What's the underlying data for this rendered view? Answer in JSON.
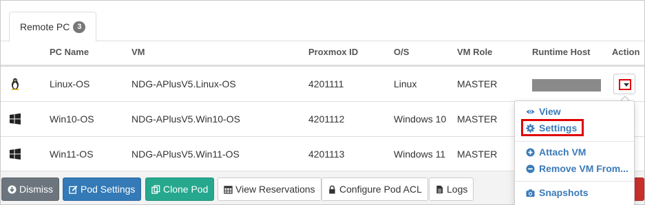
{
  "tabs": [
    {
      "label": "Remote PC",
      "count": "3"
    }
  ],
  "table": {
    "headers": [
      "PC Name",
      "VM",
      "Proxmox ID",
      "O/S",
      "VM Role",
      "Runtime Host",
      "Action"
    ],
    "rows": [
      {
        "os_icon": "linux-tux-icon",
        "pc_name": "Linux-OS",
        "vm": "NDG-APlusV5.Linux-OS",
        "proxmox_id": "4201111",
        "os": "Linux",
        "role": "MASTER"
      },
      {
        "os_icon": "windows-icon",
        "pc_name": "Win10-OS",
        "vm": "NDG-APlusV5.Win10-OS",
        "proxmox_id": "4201112",
        "os": "Windows 10",
        "role": "MASTER"
      },
      {
        "os_icon": "windows-icon",
        "pc_name": "Win11-OS",
        "vm": "NDG-APlusV5.Win11-OS",
        "proxmox_id": "4201113",
        "os": "Windows 11",
        "role": "MASTER"
      }
    ]
  },
  "action_menu": {
    "items": [
      {
        "label": "View",
        "icon": "eye-icon"
      },
      {
        "label": "Settings",
        "icon": "gear-icon"
      },
      {
        "label": "Attach VM",
        "icon": "plus-circle-icon"
      },
      {
        "label": "Remove VM From...",
        "icon": "minus-circle-icon"
      },
      {
        "label": "Snapshots",
        "icon": "camera-icon"
      }
    ]
  },
  "footer_buttons": [
    {
      "label": "Dismiss",
      "icon": "arrow-down-circle-icon"
    },
    {
      "label": "Pod Settings",
      "icon": "edit-icon"
    },
    {
      "label": "Clone Pod",
      "icon": "copy-icon"
    },
    {
      "label": "View Reservations",
      "icon": "calendar-icon"
    },
    {
      "label": "Configure Pod ACL",
      "icon": "lock-icon"
    },
    {
      "label": "Logs",
      "icon": "file-icon"
    }
  ],
  "colors": {
    "accent": "#337ab7",
    "highlight": "#e00000",
    "menu_link": "#3a7ab8"
  }
}
